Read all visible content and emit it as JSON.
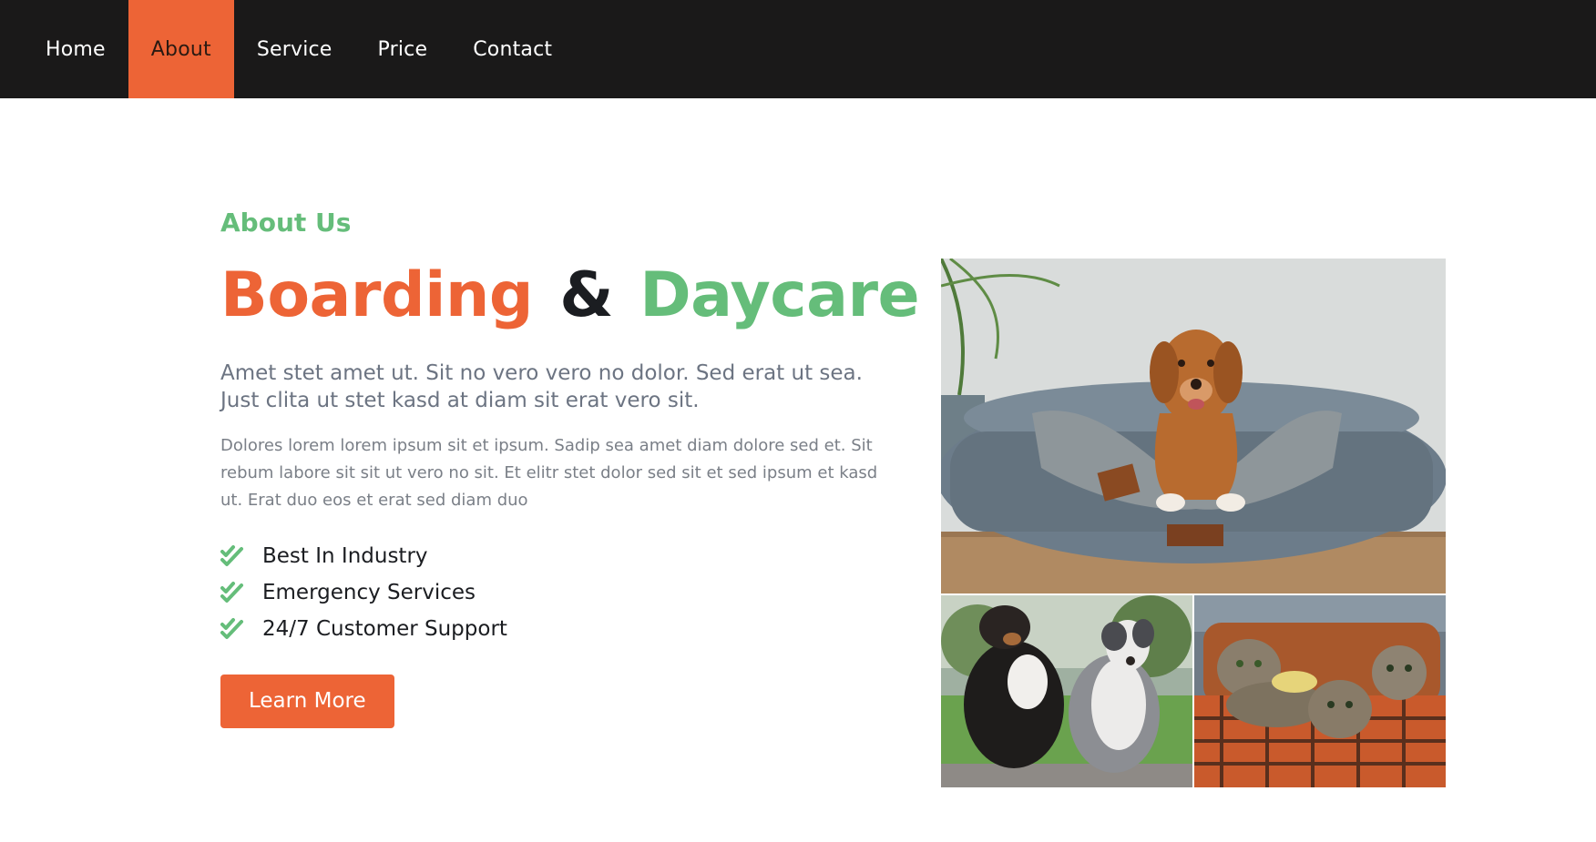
{
  "nav": {
    "items": [
      {
        "label": "Home",
        "active": false
      },
      {
        "label": "About",
        "active": true
      },
      {
        "label": "Service",
        "active": false
      },
      {
        "label": "Price",
        "active": false
      },
      {
        "label": "Contact",
        "active": false
      }
    ]
  },
  "about": {
    "eyebrow": "About Us",
    "headline": {
      "part1": "Boarding",
      "amp": "&",
      "part2": "Daycare"
    },
    "lead": "Amet stet amet ut. Sit no vero vero no dolor. Sed erat ut sea. Just clita ut stet kasd at diam sit erat vero sit.",
    "body": "Dolores lorem lorem ipsum sit et ipsum. Sadip sea amet diam dolore sed et. Sit rebum labore sit sit ut vero no sit. Et elitr stet dolor sed sit et sed ipsum et kasd ut. Erat duo eos et erat sed diam duo",
    "features": [
      {
        "label": "Best In Industry",
        "icon": "double-check-icon"
      },
      {
        "label": "Emergency Services",
        "icon": "double-check-icon"
      },
      {
        "label": "24/7 Customer Support",
        "icon": "double-check-icon"
      }
    ],
    "cta_label": "Learn More"
  },
  "gallery": {
    "images": [
      {
        "subject": "dog-on-bed-photo"
      },
      {
        "subject": "two-dogs-photo"
      },
      {
        "subject": "kittens-in-basket-photo"
      }
    ]
  },
  "colors": {
    "accent_orange": "#ed6436",
    "accent_green": "#65bd7a",
    "nav_bg": "#1a1919",
    "heading_dark": "#1b1d21",
    "lead_text": "#6c7482",
    "body_text": "#7a7f87"
  }
}
